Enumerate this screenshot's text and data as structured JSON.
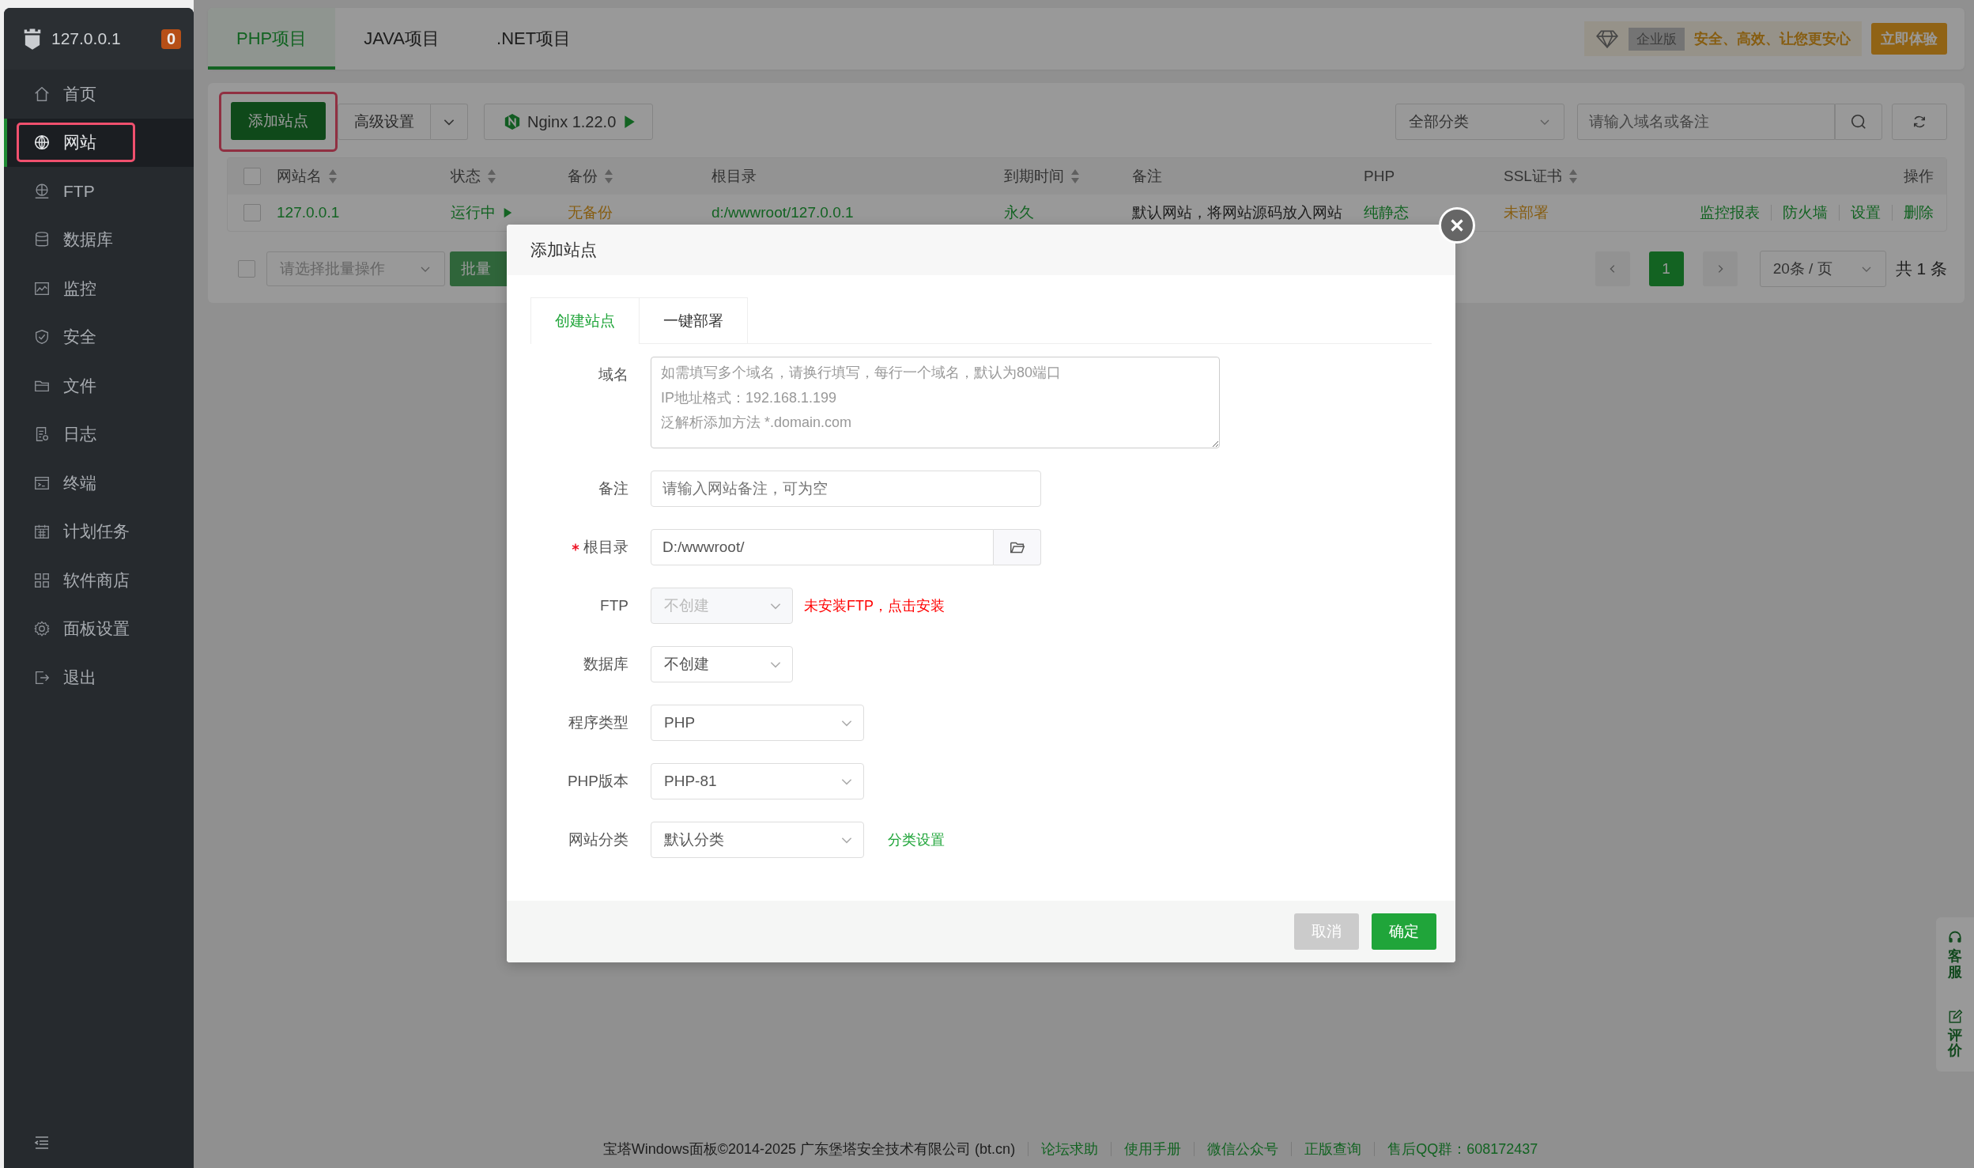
{
  "sidebar": {
    "host": "127.0.0.1",
    "badge": "0",
    "items": [
      {
        "label": "首页",
        "selected": false,
        "highlighted": false
      },
      {
        "label": "网站",
        "selected": true,
        "highlighted": true
      },
      {
        "label": "FTP",
        "selected": false,
        "highlighted": false
      },
      {
        "label": "数据库",
        "selected": false,
        "highlighted": false
      },
      {
        "label": "监控",
        "selected": false,
        "highlighted": false
      },
      {
        "label": "安全",
        "selected": false,
        "highlighted": false
      },
      {
        "label": "文件",
        "selected": false,
        "highlighted": false
      },
      {
        "label": "日志",
        "selected": false,
        "highlighted": false
      },
      {
        "label": "终端",
        "selected": false,
        "highlighted": false
      },
      {
        "label": "计划任务",
        "selected": false,
        "highlighted": false
      },
      {
        "label": "软件商店",
        "selected": false,
        "highlighted": false
      },
      {
        "label": "面板设置",
        "selected": false,
        "highlighted": false
      },
      {
        "label": "退出",
        "selected": false,
        "highlighted": false
      }
    ]
  },
  "tabs": [
    {
      "label": "PHP项目",
      "selected": true
    },
    {
      "label": "JAVA项目",
      "selected": false
    },
    {
      "label": ".NET项目",
      "selected": false
    }
  ],
  "promo": {
    "tag": "企业版",
    "slogan": "安全、高效、让您更安心",
    "button": "立即体验"
  },
  "toolbar": {
    "add_button": {
      "label": "添加站点",
      "highlighted": true
    },
    "advanced_button": "高级设置",
    "server_button": "Nginx 1.22.0",
    "category_select": "全部分类",
    "search": {
      "placeholder": "请输入域名或备注"
    }
  },
  "table": {
    "select_all_checked": false,
    "columns": [
      {
        "label": "网站名",
        "sortable": true
      },
      {
        "label": "状态",
        "sortable": true
      },
      {
        "label": "备份",
        "sortable": true
      },
      {
        "label": "根目录",
        "sortable": false
      },
      {
        "label": "到期时间",
        "sortable": true
      },
      {
        "label": "备注",
        "sortable": false
      },
      {
        "label": "PHP",
        "sortable": false
      },
      {
        "label": "SSL证书",
        "sortable": true
      },
      {
        "label": "操作",
        "sortable": false
      }
    ],
    "rows": [
      {
        "checked": false,
        "name": "127.0.0.1",
        "status": "运行中",
        "backup": "无备份",
        "root": "d:/wwwroot/127.0.0.1",
        "expiry": "永久",
        "remark": "默认网站，将网站源码放入网站",
        "php": "纯静态",
        "ssl": "未部署",
        "actions": [
          "监控报表",
          "防火墙",
          "设置",
          "删除"
        ]
      }
    ]
  },
  "batch": {
    "checked": false,
    "placeholder": "请选择批量操作",
    "button": "批量"
  },
  "pagination": {
    "pages": [
      {
        "label": "1",
        "selected": true
      }
    ],
    "page_size": "20条 / 页",
    "total": "共 1 条"
  },
  "dialog": {
    "title": "添加站点",
    "tabs": [
      {
        "label": "创建站点",
        "selected": true
      },
      {
        "label": "一键部署",
        "selected": false
      }
    ],
    "fields": [
      {
        "kind": "textarea",
        "label": "域名",
        "required": false,
        "placeholder": "如需填写多个域名，请换行填写，每行一个域名，默认为80端口\nIP地址格式：192.168.1.199\n泛解析添加方法 *.domain.com"
      },
      {
        "kind": "input",
        "label": "备注",
        "required": false,
        "placeholder": "请输入网站备注，可为空"
      },
      {
        "kind": "path",
        "label": "根目录",
        "required": true,
        "value": "D:/wwwroot/"
      },
      {
        "kind": "select",
        "label": "FTP",
        "required": false,
        "value": "不创建",
        "disabled": true,
        "warning": "未安装FTP，点击安装"
      },
      {
        "kind": "select",
        "label": "数据库",
        "required": false,
        "value": "不创建",
        "disabled": false
      },
      {
        "kind": "wideselect",
        "label": "程序类型",
        "required": false,
        "value": "PHP",
        "disabled": false
      },
      {
        "kind": "wideselect",
        "label": "PHP版本",
        "required": false,
        "value": "PHP-81",
        "disabled": false
      },
      {
        "kind": "wideselect",
        "label": "网站分类",
        "required": false,
        "value": "默认分类",
        "disabled": false,
        "link": "分类设置"
      }
    ],
    "buttons": [
      {
        "label": "取消",
        "kind": "cancel"
      },
      {
        "label": "确定",
        "kind": "primary"
      }
    ]
  },
  "footer": {
    "copyright": "宝塔Windows面板©2014-2025 广东堡塔安全技术有限公司 (bt.cn)",
    "links": [
      "论坛求助",
      "使用手册",
      "微信公众号",
      "正版查询",
      "售后QQ群：608172437"
    ]
  },
  "float_panel": [
    {
      "label": "客服"
    },
    {
      "label": "评价"
    }
  ]
}
